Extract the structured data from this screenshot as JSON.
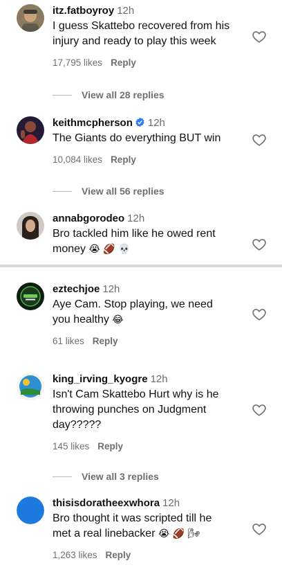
{
  "comments": [
    {
      "username": "itz.fatboyroy",
      "time": "12h",
      "lines": [
        "I guess Skattebo recovered from his",
        "injury and ready to play this week"
      ],
      "likes": "17,795 likes",
      "reply": "Reply",
      "view_replies": "View all 28 replies"
    },
    {
      "username": "keithmcpherson",
      "verified": true,
      "time": "12h",
      "lines": [
        "The Giants do everything BUT win"
      ],
      "likes": "10,084 likes",
      "reply": "Reply",
      "view_replies": "View all 56 replies"
    },
    {
      "username": "annabgorodeo",
      "time": "12h",
      "lines": [
        "Bro tackled him like he owed rent",
        "money"
      ],
      "emojis": "😭 🏈 💀",
      "likes": "",
      "reply": ""
    },
    {
      "username": "eztechjoe",
      "time": "12h",
      "lines": [
        "Aye Cam. Stop playing, we need",
        "you healthy"
      ],
      "emojis": "😂",
      "likes": "61 likes",
      "reply": "Reply"
    },
    {
      "username": "king_irving_kyogre",
      "time": "12h",
      "lines": [
        "Isn't Cam Skattebo Hurt why is he",
        "throwing punches on Judgment",
        "day?????"
      ],
      "likes": "145 likes",
      "reply": "Reply",
      "view_replies": "View all 3 replies"
    },
    {
      "username": "thisisdoratheexwhora",
      "time": "12h",
      "lines": [
        "Bro thought it was scripted till he",
        "met a real linebacker"
      ],
      "emojis": "😭 🏈 🌬",
      "likes": "1,263 likes",
      "reply": "Reply"
    }
  ],
  "colors": {
    "text": "#111111",
    "secondary": "#6f6f6f",
    "verified": "#2f7cf6",
    "divider": "#d9d9d9",
    "avatar_blue": "#1f7ae0"
  },
  "icons": {
    "like": "heart-outline-icon",
    "verified": "verified-badge-icon"
  }
}
